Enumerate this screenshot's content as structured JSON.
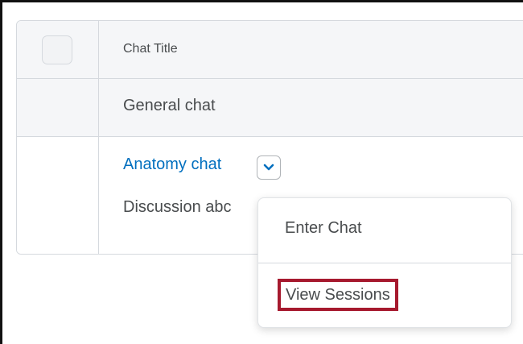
{
  "table": {
    "header": {
      "column_title": "Chat Title"
    },
    "rows": [
      {
        "title": "General chat"
      },
      {
        "title": "Anatomy chat",
        "description": "Discussion abc"
      }
    ]
  },
  "menu": {
    "items": [
      {
        "label": "Enter Chat"
      },
      {
        "label": "View Sessions",
        "highlighted": true
      }
    ],
    "highlight_color": "#a6192e"
  },
  "icons": {
    "dropdown": "chevron-down-icon"
  },
  "colors": {
    "link": "#006fbf",
    "text": "#494c4e",
    "header_bg": "#f5f6f8"
  }
}
